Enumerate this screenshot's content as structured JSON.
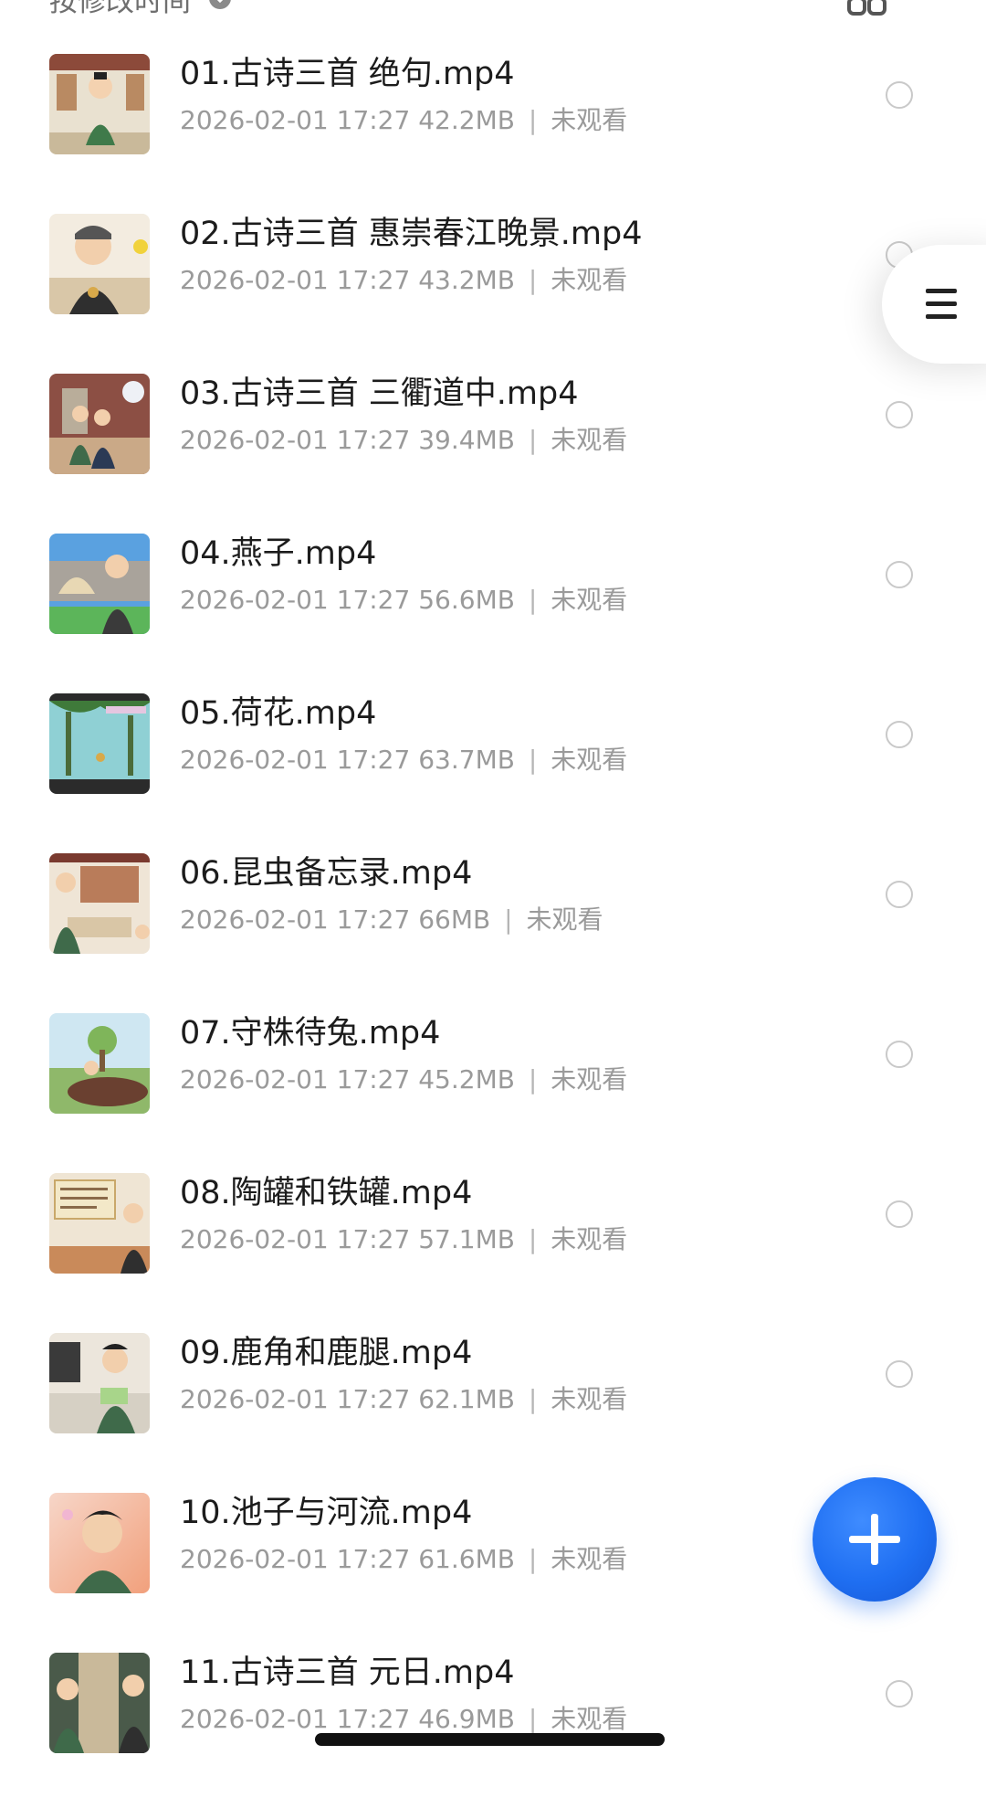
{
  "header": {
    "sort_label": "按修改时间",
    "sort_icon": "sort-arrows-icon",
    "view_toggle_icon": "grid-view-icon"
  },
  "files": [
    {
      "name": "01.古诗三首 绝句.mp4",
      "date": "2026-02-01 17:27",
      "size": "42.2MB",
      "status": "未观看"
    },
    {
      "name": "02.古诗三首 惠崇春江晚景.mp4",
      "date": "2026-02-01 17:27",
      "size": "43.2MB",
      "status": "未观看"
    },
    {
      "name": "03.古诗三首 三衢道中.mp4",
      "date": "2026-02-01 17:27",
      "size": "39.4MB",
      "status": "未观看"
    },
    {
      "name": "04.燕子.mp4",
      "date": "2026-02-01 17:27",
      "size": "56.6MB",
      "status": "未观看"
    },
    {
      "name": "05.荷花.mp4",
      "date": "2026-02-01 17:27",
      "size": "63.7MB",
      "status": "未观看"
    },
    {
      "name": "06.昆虫备忘录.mp4",
      "date": "2026-02-01 17:27",
      "size": "66MB",
      "status": "未观看"
    },
    {
      "name": "07.守株待兔.mp4",
      "date": "2026-02-01 17:27",
      "size": "45.2MB",
      "status": "未观看"
    },
    {
      "name": "08.陶罐和铁罐.mp4",
      "date": "2026-02-01 17:27",
      "size": "57.1MB",
      "status": "未观看"
    },
    {
      "name": "09.鹿角和鹿腿.mp4",
      "date": "2026-02-01 17:27",
      "size": "62.1MB",
      "status": "未观看"
    },
    {
      "name": "10.池子与河流.mp4",
      "date": "2026-02-01 17:27",
      "size": "61.6MB",
      "status": "未观看"
    },
    {
      "name": "11.古诗三首 元日.mp4",
      "date": "2026-02-01 17:27",
      "size": "46.9MB",
      "status": "未观看"
    }
  ],
  "meta_separator": "|",
  "side_menu_icon": "menu-lines-icon",
  "fab_icon": "plus-icon",
  "colors": {
    "accent": "#1f6ff2",
    "meta_text": "#9a9a9a",
    "title_text": "#1c1c1c"
  }
}
